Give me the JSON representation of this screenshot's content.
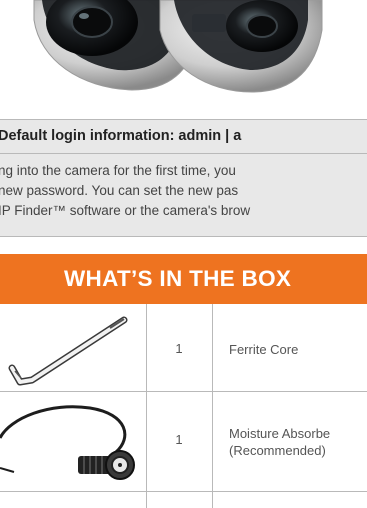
{
  "notice": {
    "title": "Default login information: admin | a",
    "lines": [
      "ng into the camera for the first time, you",
      " new password. You can set the new pas",
      "IP Finder™ software or the camera's brow"
    ]
  },
  "box": {
    "title": "WHAT’S IN THE BOX",
    "items": [
      {
        "qty": "1",
        "description": "Ferrite Core",
        "icon": "allen-wrench-icon"
      },
      {
        "qty": "1",
        "description_line1": "Moisture Absorbe",
        "description_line2": "(Recommended)",
        "icon": "cable-connector-icon"
      }
    ]
  },
  "colors": {
    "accent": "#ee7320",
    "notice_bg": "#e8e8e8",
    "border": "#b9b9b9"
  }
}
